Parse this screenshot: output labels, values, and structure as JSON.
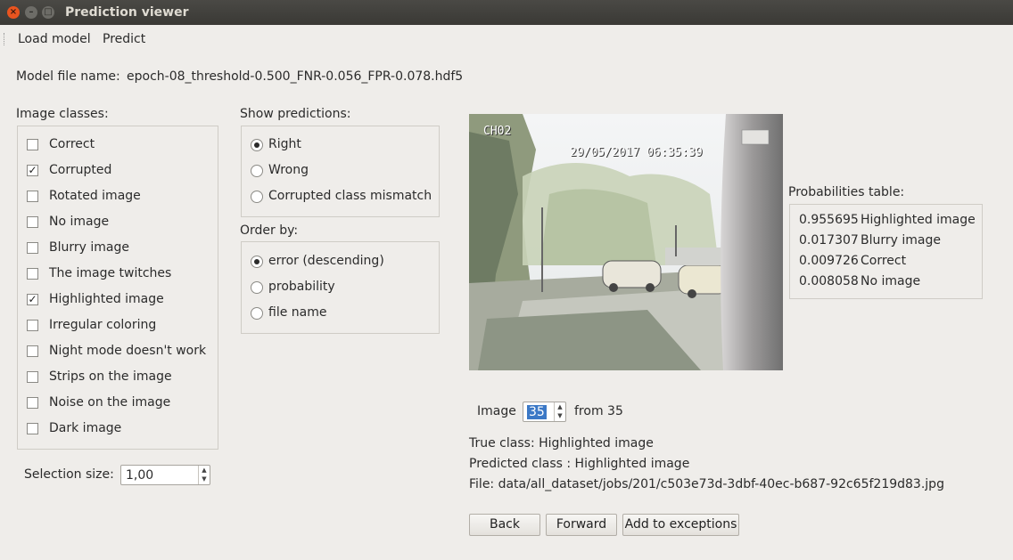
{
  "window": {
    "title": "Prediction viewer",
    "close_glyph": "×",
    "min_glyph": "–",
    "max_glyph": "□"
  },
  "menu": [
    "Load model",
    "Predict"
  ],
  "model": {
    "label": "Model file name:",
    "value": "epoch-08_threshold-0.500_FNR-0.056_FPR-0.078.hdf5"
  },
  "image_classes": {
    "label": "Image classes:",
    "items": [
      {
        "label": "Correct",
        "checked": false
      },
      {
        "label": "Corrupted",
        "checked": true
      },
      {
        "label": "Rotated image",
        "checked": false
      },
      {
        "label": "No image",
        "checked": false
      },
      {
        "label": "Blurry image",
        "checked": false
      },
      {
        "label": "The image twitches",
        "checked": false
      },
      {
        "label": "Highlighted image",
        "checked": true
      },
      {
        "label": "Irregular coloring",
        "checked": false
      },
      {
        "label": "Night mode doesn't work",
        "checked": false
      },
      {
        "label": "Strips on the image",
        "checked": false
      },
      {
        "label": "Noise on the image",
        "checked": false
      },
      {
        "label": "Dark image",
        "checked": false
      }
    ]
  },
  "show_predictions": {
    "label": "Show predictions:",
    "options": [
      {
        "label": "Right",
        "selected": true
      },
      {
        "label": "Wrong",
        "selected": false
      },
      {
        "label": "Corrupted class mismatch",
        "selected": false
      }
    ]
  },
  "order_by": {
    "label": "Order by:",
    "options": [
      {
        "label": "error (descending)",
        "selected": true
      },
      {
        "label": "probability",
        "selected": false
      },
      {
        "label": "file name",
        "selected": false
      }
    ]
  },
  "selection_size": {
    "label": "Selection size:",
    "value": "1,00"
  },
  "image_overlay": {
    "channel": "CH02",
    "timestamp": "29/05/2017 06:35:39"
  },
  "probabilities": {
    "label": "Probabilities table:",
    "rows": [
      {
        "value": "0.955695",
        "class": "Highlighted image"
      },
      {
        "value": "0.017307",
        "class": "Blurry image"
      },
      {
        "value": "0.009726",
        "class": "Correct"
      },
      {
        "value": "0.008058",
        "class": "No image"
      }
    ]
  },
  "navigator": {
    "label": "Image",
    "value": "35",
    "from_text": "from 35"
  },
  "info": {
    "true_class": "True class: Highlighted image",
    "predicted_class": "Predicted class : Highlighted image",
    "file": "File: data/all_dataset/jobs/201/c503e73d-3dbf-40ec-b687-92c65f219d83.jpg"
  },
  "buttons": {
    "back": "Back",
    "forward": "Forward",
    "add_exceptions": "Add to exceptions"
  },
  "icons": {
    "close": "close-icon",
    "minimize": "minimize-icon",
    "maximize": "maximize-icon"
  }
}
